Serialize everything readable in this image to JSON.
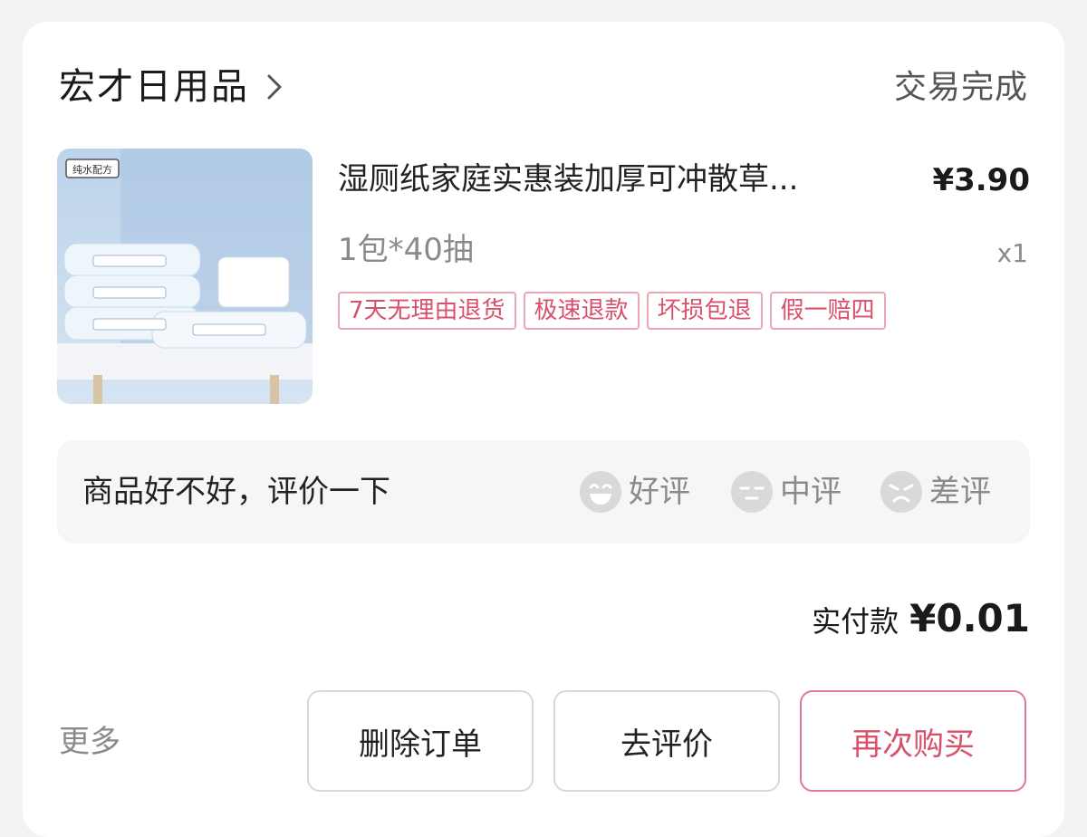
{
  "order": {
    "shop_name": "宏才日用品",
    "status": "交易完成",
    "item": {
      "badge": "纯水配方",
      "title": "湿厕纸家庭实惠装加厚可冲散草...",
      "price": "¥3.90",
      "spec": "1包*40抽",
      "quantity": "x1",
      "tags": [
        "7天无理由退货",
        "极速退款",
        "坏损包退",
        "假一赔四"
      ]
    },
    "review": {
      "prompt": "商品好不好，评价一下",
      "options": [
        {
          "label": "好评",
          "icon": "smile-face-icon"
        },
        {
          "label": "中评",
          "icon": "neutral-face-icon"
        },
        {
          "label": "差评",
          "icon": "frown-face-icon"
        }
      ]
    },
    "payment": {
      "label": "实付款",
      "amount": "¥0.01"
    },
    "actions": {
      "more_label": "更多",
      "delete_label": "删除订单",
      "review_label": "去评价",
      "rebuy_label": "再次购买"
    }
  },
  "colors": {
    "accent": "#d9506a",
    "tag_border": "#e9a8b3",
    "muted_text": "#8a8a8a",
    "review_bg": "#f6f6f8"
  }
}
